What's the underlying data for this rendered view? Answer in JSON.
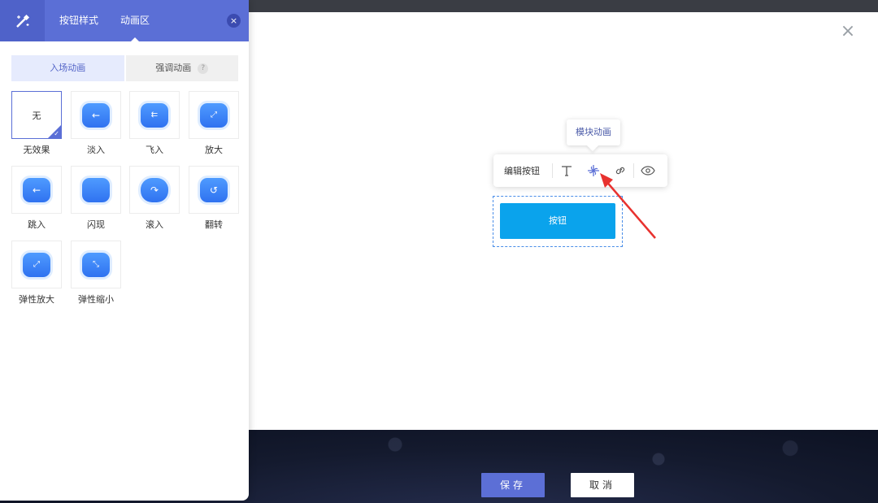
{
  "dialog": {
    "close_glyph": "×"
  },
  "panel": {
    "tabs": [
      {
        "label": "按钮样式"
      },
      {
        "label": "动画区"
      }
    ],
    "close_glyph": "×",
    "subtabs": [
      {
        "label": "入场动画",
        "active": true
      },
      {
        "label": "强调动画",
        "help": "?"
      }
    ],
    "animations": [
      {
        "label": "无效果",
        "card_text": "无",
        "selected": true,
        "icon": "none"
      },
      {
        "label": "淡入",
        "icon": "arrow-left-icon"
      },
      {
        "label": "飞入",
        "icon": "fly-in-icon"
      },
      {
        "label": "放大",
        "icon": "expand-icon"
      },
      {
        "label": "跳入",
        "icon": "bounce-in-icon"
      },
      {
        "label": "闪现",
        "icon": "flash-icon"
      },
      {
        "label": "滚入",
        "icon": "roll-in-icon"
      },
      {
        "label": "翻转",
        "icon": "flip-icon"
      },
      {
        "label": "弹性放大",
        "icon": "elastic-expand-icon"
      },
      {
        "label": "弹性缩小",
        "icon": "elastic-shrink-icon"
      }
    ]
  },
  "toolbar": {
    "edit_label": "编辑按钮",
    "tooltip": "模块动画",
    "icons": [
      "text-icon",
      "animation-icon",
      "link-icon",
      "eye-icon"
    ]
  },
  "canvas": {
    "button_label": "按钮"
  },
  "footer": {
    "save_label": "保存",
    "cancel_label": "取消"
  },
  "colors": {
    "accent": "#5b6fd6",
    "button_blue": "#0aa3ec",
    "arrow_red": "#e8322f"
  }
}
